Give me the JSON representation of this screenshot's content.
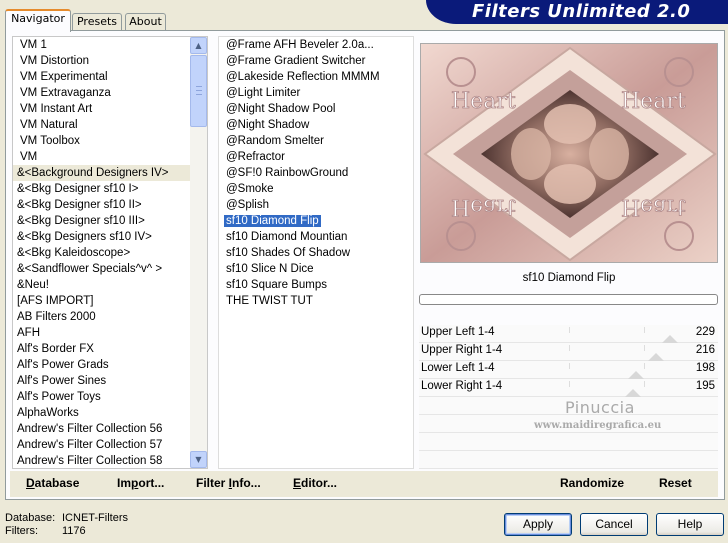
{
  "app": {
    "title": "Filters Unlimited 2.0"
  },
  "tabs": [
    {
      "label": "Navigator",
      "active": true
    },
    {
      "label": "Presets",
      "active": false
    },
    {
      "label": "About",
      "active": false
    }
  ],
  "categories": {
    "items": [
      "VM 1",
      "VM Distortion",
      "VM Experimental",
      "VM Extravaganza",
      "VM Instant Art",
      "VM Natural",
      "VM Toolbox",
      "VM",
      "&<Background Designers IV>",
      "&<Bkg Designer sf10 I>",
      "&<Bkg Designer sf10 II>",
      "&<Bkg Designer sf10 III>",
      "&<Bkg Designers sf10 IV>",
      "&<Bkg Kaleidoscope>",
      "&<Sandflower Specials^v^ >",
      "&Neu!",
      "[AFS IMPORT]",
      "AB Filters 2000",
      "AFH",
      "Alf's Border FX",
      "Alf's Power Grads",
      "Alf's Power Sines",
      "Alf's Power Toys",
      "AlphaWorks",
      "Andrew's Filter Collection 56",
      "Andrew's Filter Collection 57",
      "Andrew's Filter Collection 58"
    ],
    "selected_index": 8
  },
  "filters": {
    "items": [
      "@Frame AFH Beveler 2.0a...",
      "@Frame Gradient Switcher",
      "@Lakeside Reflection MMMM",
      "@Light Limiter",
      "@Night Shadow Pool",
      "@Night Shadow",
      "@Random Smelter",
      "@Refractor",
      "@SF!0 RainbowGround",
      "@Smoke",
      "@Splish",
      "sf10 Diamond Flip",
      "sf10 Diamond Mountian",
      "sf10 Shades Of Shadow",
      "sf10 Slice N Dice",
      "sf10 Square Bumps",
      "THE TWIST TUT"
    ],
    "selected_index": 11
  },
  "preview": {
    "filter_name": "sf10 Diamond Flip",
    "colors": {
      "bg": "#e8c8c0",
      "mid": "#c49c98",
      "dark": "#6e4a42",
      "light": "#f5e6dc"
    }
  },
  "sliders": [
    {
      "label": "Upper Left 1-4",
      "value": "229",
      "level": 229
    },
    {
      "label": "Upper Right 1-4",
      "value": "216",
      "level": 216
    },
    {
      "label": "Lower Left 1-4",
      "value": "198",
      "level": 198
    },
    {
      "label": "Lower Right 1-4",
      "value": "195",
      "level": 195
    }
  ],
  "watermark": {
    "line1": "Pinuccia",
    "line2": "www.maidiregrafica.eu"
  },
  "toolbar": {
    "database": {
      "u": "D",
      "rest": "atabase"
    },
    "import": {
      "pre": "Im",
      "u": "p",
      "rest": "ort..."
    },
    "filter_info": {
      "pre": "Filter ",
      "u": "I",
      "rest": "nfo..."
    },
    "editor": {
      "u": "E",
      "rest": "ditor..."
    },
    "randomize": "Randomize",
    "reset": "Reset"
  },
  "status": {
    "database_label": "Database:",
    "database_value": "ICNET-Filters",
    "filters_label": "Filters:",
    "filters_value": "1176"
  },
  "buttons": {
    "apply": "Apply",
    "cancel": "Cancel",
    "help": "Help"
  }
}
